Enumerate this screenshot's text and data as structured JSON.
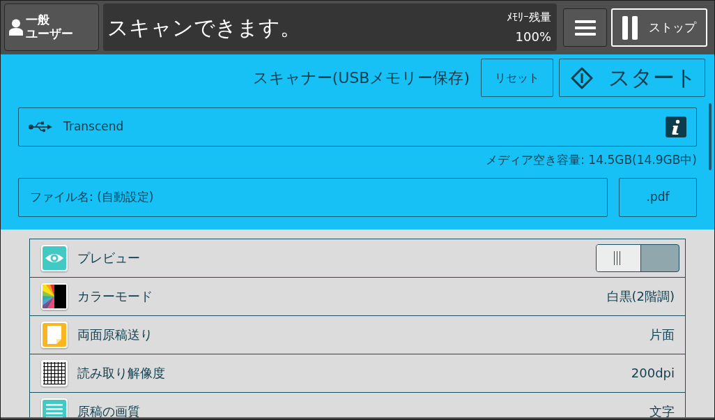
{
  "header": {
    "user_button": {
      "lines": [
        "一般",
        "ユーザー"
      ]
    },
    "message": "スキャンできます。",
    "memory": {
      "label": "ﾒﾓﾘｰ残量",
      "value": "100%"
    },
    "stop_button": {
      "label": "ストップ"
    }
  },
  "scan_panel": {
    "title": "スキャナー(USBメモリー保存)",
    "reset_button": "リセット",
    "start_button": "スタート",
    "device": {
      "name": "Transcend"
    },
    "free_space": "メディア空き容量: 14.5GB(14.9GB中)",
    "file_name": "ファイル名: (自動設定)",
    "file_type": ".pdf"
  },
  "settings": [
    {
      "kind": "toggle",
      "label": "プレビュー",
      "on": false
    },
    {
      "kind": "value",
      "label": "カラーモード",
      "value": "白黒(2階調)"
    },
    {
      "kind": "value",
      "label": "両面原稿送り",
      "value": "片面"
    },
    {
      "kind": "value",
      "label": "読み取り解像度",
      "value": "200dpi"
    },
    {
      "kind": "value",
      "label": "原稿の画質",
      "value": "文字"
    }
  ]
}
